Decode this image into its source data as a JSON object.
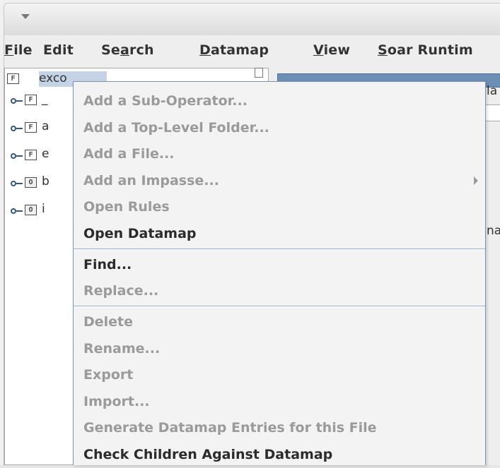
{
  "menubar": {
    "items": [
      {
        "mnemonic": "F",
        "rest": "ile"
      },
      {
        "mnemonic": "",
        "rest": "Edit"
      },
      {
        "pre": "Se",
        "mnemonic": "a",
        "rest": "rch"
      },
      {
        "mnemonic": "D",
        "rest": "atamap"
      },
      {
        "mnemonic": "V",
        "rest": "iew"
      },
      {
        "mnemonic": "S",
        "rest": "oar Runtim"
      }
    ]
  },
  "tree": {
    "root_label": "exco",
    "root_icon": "file-icon",
    "children": [
      {
        "icon": "file-icon",
        "glyph": "F",
        "label": "_"
      },
      {
        "icon": "file-icon",
        "glyph": "F",
        "label": "a"
      },
      {
        "icon": "file-icon",
        "glyph": "F",
        "label": "e"
      },
      {
        "icon": "operator-icon",
        "glyph": "O",
        "label": "b"
      },
      {
        "icon": "operator-icon",
        "glyph": "O",
        "label": "i"
      }
    ]
  },
  "right_panel": {
    "top_text": "la",
    "mid_text": "na"
  },
  "context_menu": {
    "items": [
      {
        "label": "Add a Sub-Operator...",
        "enabled": false
      },
      {
        "label": "Add a Top-Level Folder...",
        "enabled": false
      },
      {
        "label": "Add a File...",
        "enabled": false
      },
      {
        "label": "Add an Impasse...",
        "enabled": false,
        "submenu": true
      },
      {
        "label": "Open Rules",
        "enabled": false
      },
      {
        "label": "Open Datamap",
        "enabled": true
      },
      {
        "label": "Find...",
        "enabled": true
      },
      {
        "label": "Replace...",
        "enabled": false
      },
      {
        "label": "Delete",
        "enabled": false
      },
      {
        "label": "Rename...",
        "enabled": false
      },
      {
        "label": "Export",
        "enabled": false
      },
      {
        "label": "Import...",
        "enabled": false
      },
      {
        "label": "Generate Datamap Entries for this File",
        "enabled": false
      },
      {
        "label": "Check Children Against Datamap",
        "enabled": true
      }
    ]
  },
  "colors": {
    "selection": "#c4d4e6",
    "menu_border": "#7d93b3",
    "disabled_text": "#9a9a9a",
    "enabled_text": "#2b2b2b"
  }
}
